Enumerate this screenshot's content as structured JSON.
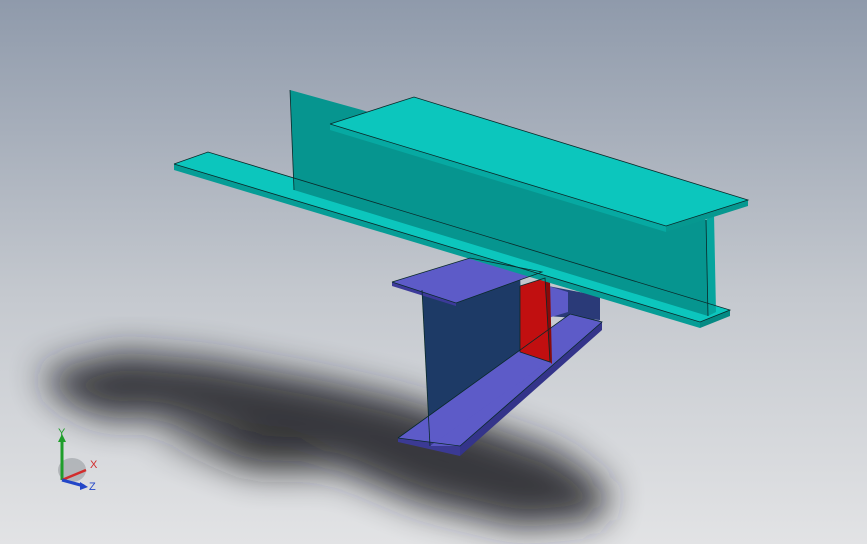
{
  "viewport": {
    "background_top": "#8f9aab",
    "background_mid": "#c5c9cf",
    "background_bottom": "#e2e3e5"
  },
  "model": {
    "upper_beam_color": "#07b3ab",
    "upper_beam_top_color": "#0cc6bd",
    "upper_beam_web_color": "#06958f",
    "lower_beam_flange_color": "#5d5bc8",
    "lower_beam_web_color": "#1d3a66",
    "connector_plate_color": "#c10f10"
  },
  "triad": {
    "y_label": "Y",
    "x_label": "X",
    "z_label": "Z",
    "y_color": "#1f9e2b",
    "x_color": "#d22c2c",
    "z_color": "#2346c8"
  }
}
